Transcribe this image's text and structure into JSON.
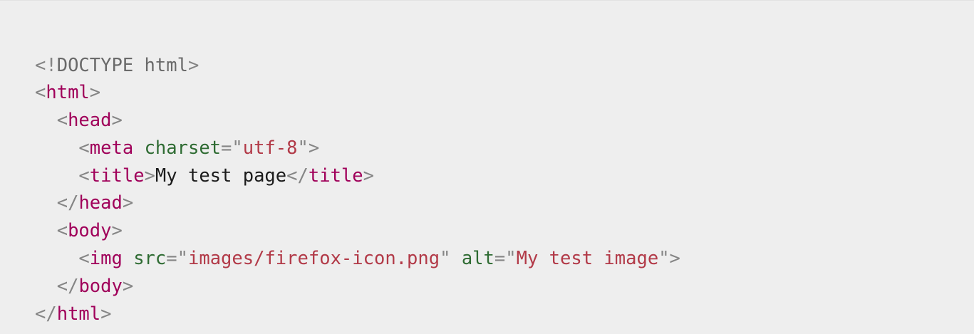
{
  "code_lines": [
    {
      "indent": "",
      "tokens": [
        {
          "t": "punct",
          "v": "<!"
        },
        {
          "t": "doctype",
          "v": "DOCTYPE html"
        },
        {
          "t": "punct",
          "v": ">"
        }
      ]
    },
    {
      "indent": "",
      "tokens": [
        {
          "t": "punct",
          "v": "<"
        },
        {
          "t": "tag",
          "v": "html"
        },
        {
          "t": "punct",
          "v": ">"
        }
      ]
    },
    {
      "indent": "  ",
      "tokens": [
        {
          "t": "punct",
          "v": "<"
        },
        {
          "t": "tag",
          "v": "head"
        },
        {
          "t": "punct",
          "v": ">"
        }
      ]
    },
    {
      "indent": "    ",
      "tokens": [
        {
          "t": "punct",
          "v": "<"
        },
        {
          "t": "tag",
          "v": "meta"
        },
        {
          "t": "text",
          "v": " "
        },
        {
          "t": "attr",
          "v": "charset"
        },
        {
          "t": "punct",
          "v": "=\""
        },
        {
          "t": "val",
          "v": "utf-8"
        },
        {
          "t": "punct",
          "v": "\">"
        }
      ]
    },
    {
      "indent": "    ",
      "tokens": [
        {
          "t": "punct",
          "v": "<"
        },
        {
          "t": "tag",
          "v": "title"
        },
        {
          "t": "punct",
          "v": ">"
        },
        {
          "t": "text",
          "v": "My test page"
        },
        {
          "t": "punct",
          "v": "</"
        },
        {
          "t": "tag",
          "v": "title"
        },
        {
          "t": "punct",
          "v": ">"
        }
      ]
    },
    {
      "indent": "  ",
      "tokens": [
        {
          "t": "punct",
          "v": "</"
        },
        {
          "t": "tag",
          "v": "head"
        },
        {
          "t": "punct",
          "v": ">"
        }
      ]
    },
    {
      "indent": "  ",
      "tokens": [
        {
          "t": "punct",
          "v": "<"
        },
        {
          "t": "tag",
          "v": "body"
        },
        {
          "t": "punct",
          "v": ">"
        }
      ]
    },
    {
      "indent": "    ",
      "tokens": [
        {
          "t": "punct",
          "v": "<"
        },
        {
          "t": "tag",
          "v": "img"
        },
        {
          "t": "text",
          "v": " "
        },
        {
          "t": "attr",
          "v": "src"
        },
        {
          "t": "punct",
          "v": "=\""
        },
        {
          "t": "val",
          "v": "images/firefox-icon.png"
        },
        {
          "t": "punct",
          "v": "\""
        },
        {
          "t": "text",
          "v": " "
        },
        {
          "t": "attr",
          "v": "alt"
        },
        {
          "t": "punct",
          "v": "=\""
        },
        {
          "t": "val",
          "v": "My test image"
        },
        {
          "t": "punct",
          "v": "\">"
        }
      ]
    },
    {
      "indent": "  ",
      "tokens": [
        {
          "t": "punct",
          "v": "</"
        },
        {
          "t": "tag",
          "v": "body"
        },
        {
          "t": "punct",
          "v": ">"
        }
      ]
    },
    {
      "indent": "",
      "tokens": [
        {
          "t": "punct",
          "v": "</"
        },
        {
          "t": "tag",
          "v": "html"
        },
        {
          "t": "punct",
          "v": ">"
        }
      ]
    }
  ],
  "colors": {
    "background": "#eeeeee",
    "tag": "#a0005a",
    "attribute": "#2e6b32",
    "value": "#b23a48",
    "punctuation": "#858585",
    "text": "#1b1b1b"
  }
}
